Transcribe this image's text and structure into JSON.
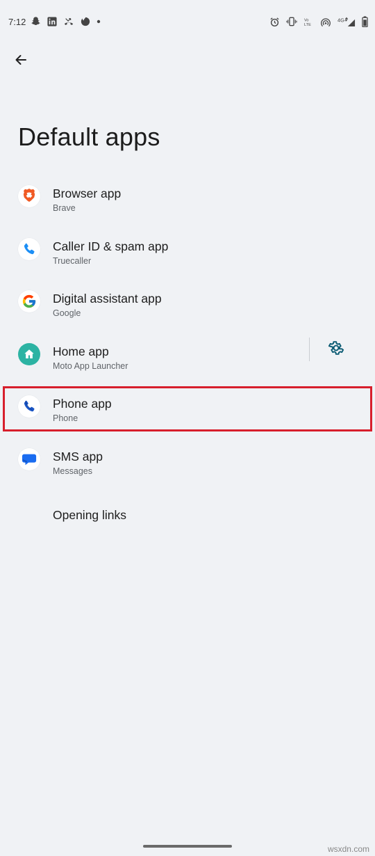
{
  "status_bar": {
    "time": "7:12",
    "network": "4G+",
    "volte": "VoLTE"
  },
  "page": {
    "title": "Default apps"
  },
  "items": [
    {
      "title": "Browser app",
      "subtitle": "Brave",
      "icon": "brave-icon"
    },
    {
      "title": "Caller ID & spam app",
      "subtitle": "Truecaller",
      "icon": "truecaller-icon"
    },
    {
      "title": "Digital assistant app",
      "subtitle": "Google",
      "icon": "google-icon"
    },
    {
      "title": "Home app",
      "subtitle": "Moto App Launcher",
      "icon": "home-icon",
      "has_settings": true
    },
    {
      "title": "Phone app",
      "subtitle": "Phone",
      "icon": "phone-icon",
      "highlighted": true
    },
    {
      "title": "SMS app",
      "subtitle": "Messages",
      "icon": "messages-icon"
    },
    {
      "title": "Opening links"
    }
  ],
  "watermark": "wsxdn.com",
  "colors": {
    "background": "#f0f2f5",
    "highlight": "#d71f2c",
    "accent": "#0b5b73"
  }
}
